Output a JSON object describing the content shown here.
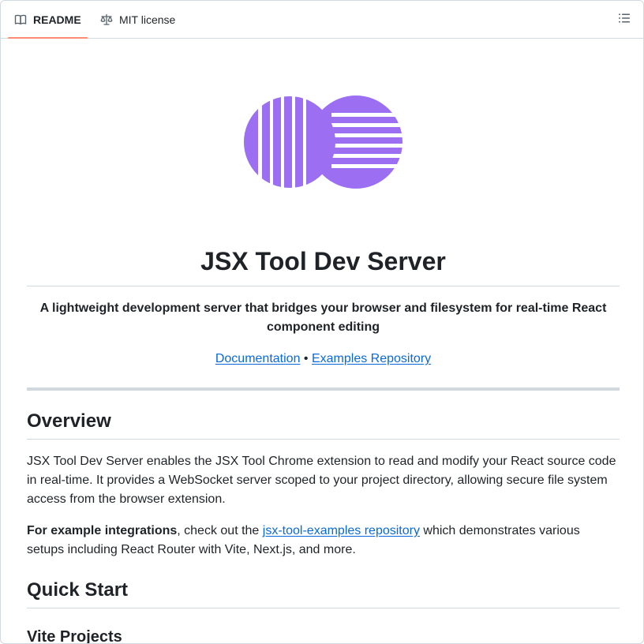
{
  "tabs": {
    "readme": "README",
    "license": "MIT license"
  },
  "readme": {
    "title": "JSX Tool Dev Server",
    "subtitle": "A lightweight development server that bridges your browser and filesystem for real-time React component editing",
    "links": {
      "documentation": "Documentation",
      "separator": " • ",
      "examples": "Examples Repository"
    },
    "overview": {
      "heading": "Overview",
      "paragraph": "JSX Tool Dev Server enables the JSX Tool Chrome extension to read and modify your React source code in real-time. It provides a WebSocket server scoped to your project directory, allowing secure file system access from the browser extension.",
      "integrations_bold": "For example integrations",
      "integrations_pre": ", check out the ",
      "integrations_link": "jsx-tool-examples repository",
      "integrations_post": " which demonstrates various setups including React Router with Vite, Next.js, and more."
    },
    "quick_start": {
      "heading": "Quick Start",
      "vite_heading": "Vite Projects"
    }
  },
  "colors": {
    "logo": "#9c6ff2",
    "active_tab_underline": "#fd8c73",
    "link": "#0969da"
  },
  "icons": {
    "readme_tab": "book-icon",
    "license_tab": "scale-icon",
    "outline": "list-icon"
  }
}
